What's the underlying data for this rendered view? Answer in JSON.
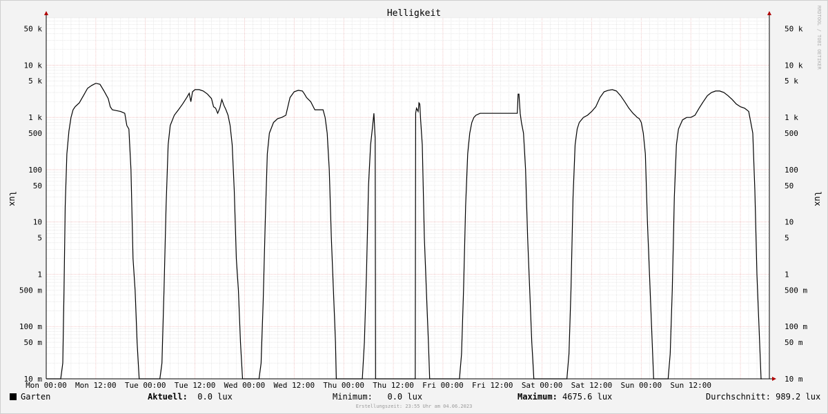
{
  "chart_data": {
    "type": "line",
    "title": "Helligkeit",
    "ylabel": "lux",
    "yscale": "log",
    "ylim": [
      0.01,
      80000
    ],
    "xlabel": "",
    "xlim_hours": [
      0,
      175
    ],
    "x_ticks": [
      "Mon 00:00",
      "Mon 12:00",
      "Tue 00:00",
      "Tue 12:00",
      "Wed 00:00",
      "Wed 12:00",
      "Thu 00:00",
      "Thu 12:00",
      "Fri 00:00",
      "Fri 12:00",
      "Sat 00:00",
      "Sat 12:00",
      "Sun 00:00",
      "Sun 12:00"
    ],
    "y_ticks": [
      {
        "v": 50000,
        "label": "50 k"
      },
      {
        "v": 10000,
        "label": "10 k"
      },
      {
        "v": 5000,
        "label": "5 k"
      },
      {
        "v": 1000,
        "label": "1 k"
      },
      {
        "v": 500,
        "label": "500"
      },
      {
        "v": 100,
        "label": "100"
      },
      {
        "v": 50,
        "label": "50"
      },
      {
        "v": 10,
        "label": "10"
      },
      {
        "v": 5,
        "label": "5"
      },
      {
        "v": 1,
        "label": "1"
      },
      {
        "v": 0.5,
        "label": "500 m"
      },
      {
        "v": 0.1,
        "label": "100 m"
      },
      {
        "v": 0.05,
        "label": "50 m"
      },
      {
        "v": 0.01,
        "label": "10 m"
      }
    ],
    "grid": true,
    "series": [
      {
        "name": "Garten",
        "color": "#000000",
        "x_hours": [
          0,
          3.5,
          4,
          4.3,
          4.6,
          5,
          5.5,
          6,
          6.5,
          7,
          8,
          9,
          10,
          11,
          12,
          13,
          14,
          15,
          15.5,
          16,
          17,
          18,
          19,
          19.5,
          20,
          20.5,
          21,
          21.5,
          22,
          22.5,
          22.7,
          27.5,
          28,
          28.5,
          29,
          29.5,
          30,
          31,
          32,
          33,
          34,
          34.6,
          35,
          35.4,
          36,
          37,
          38,
          39,
          40,
          40.5,
          41,
          41.5,
          42,
          42.5,
          43,
          43.5,
          44,
          44.5,
          45,
          45.5,
          46,
          46.5,
          47,
          47.5,
          47.9,
          51.5,
          52,
          52.5,
          53,
          53.5,
          54,
          55,
          56,
          57,
          58,
          59,
          60,
          61,
          62,
          62.5,
          63,
          64,
          65,
          66,
          67,
          67.5,
          68,
          68.5,
          69,
          69.5,
          70,
          70.2,
          76.5,
          77,
          77.5,
          78,
          78.5,
          79,
          79.3,
          79.6,
          79.7,
          89.3,
          89.4,
          89.6,
          90,
          90.2,
          90.4,
          90.6,
          91,
          91.5,
          92,
          92.5,
          92.8,
          100,
          100.5,
          101,
          101.5,
          102,
          102.5,
          103,
          103.5,
          104,
          105,
          106,
          107,
          108,
          110,
          112,
          113,
          114,
          114.2,
          114.4,
          114.7,
          115,
          115.5,
          116,
          116.5,
          117,
          117.5,
          118,
          118.2,
          126,
          126.5,
          127,
          127.5,
          128,
          128.5,
          129,
          130,
          131,
          132,
          133,
          134,
          135,
          136,
          137,
          138,
          139,
          140,
          141,
          142,
          142.5,
          143,
          143.5,
          144,
          144.5,
          145,
          145.5,
          146,
          146.5,
          147,
          147.3,
          150.5,
          151,
          151.5,
          152,
          152.5,
          153,
          154,
          155,
          156,
          157,
          158,
          159,
          160,
          161,
          162,
          163,
          164,
          165,
          166,
          167,
          168,
          169,
          169.5,
          170,
          170.5,
          171,
          171.5,
          172,
          172.5,
          173,
          173.2
        ],
        "y_lux": [
          0.01,
          0.01,
          0.02,
          0.5,
          20,
          200,
          550,
          1000,
          1400,
          1600,
          1900,
          2600,
          3600,
          4100,
          4500,
          4300,
          3200,
          2300,
          1600,
          1400,
          1350,
          1300,
          1200,
          700,
          600,
          100,
          2,
          0.5,
          0.05,
          0.01,
          0.01,
          0.01,
          0.02,
          0.5,
          20,
          300,
          700,
          1100,
          1400,
          1800,
          2400,
          2900,
          2000,
          3100,
          3400,
          3400,
          3200,
          2800,
          2300,
          1600,
          1500,
          1200,
          1500,
          2200,
          1700,
          1400,
          1100,
          700,
          300,
          40,
          2,
          0.5,
          0.05,
          0.01,
          0.01,
          0.01,
          0.02,
          0.3,
          10,
          200,
          500,
          800,
          950,
          1000,
          1100,
          2400,
          3100,
          3300,
          3200,
          2800,
          2400,
          2000,
          1400,
          1400,
          1400,
          1000,
          500,
          100,
          5,
          0.5,
          0.05,
          0.01,
          0.01,
          0.05,
          1,
          50,
          300,
          700,
          1200,
          400,
          0.01,
          0.01,
          1200,
          1500,
          1300,
          1900,
          1800,
          900,
          300,
          5,
          0.5,
          0.05,
          0.01,
          0.01,
          0.03,
          0.5,
          20,
          200,
          500,
          800,
          1000,
          1100,
          1200,
          1200,
          1200,
          1200,
          1200,
          1200,
          1200,
          1200,
          2800,
          2800,
          1200,
          800,
          500,
          100,
          5,
          0.5,
          0.05,
          0.01,
          0.01,
          0.01,
          0.03,
          0.5,
          30,
          300,
          600,
          800,
          1000,
          1100,
          1300,
          1600,
          2400,
          3100,
          3300,
          3400,
          3200,
          2600,
          2000,
          1500,
          1200,
          1100,
          1000,
          950,
          800,
          500,
          200,
          10,
          1,
          0.1,
          0.01,
          0.01,
          0.01,
          0.03,
          0.5,
          30,
          300,
          600,
          900,
          1000,
          1000,
          1100,
          1500,
          2000,
          2600,
          3000,
          3200,
          3200,
          3000,
          2600,
          2200,
          1800,
          1600,
          1500,
          1400,
          1300,
          800,
          500,
          40,
          1,
          0.1,
          0.01,
          0.01
        ]
      }
    ]
  },
  "legend": {
    "series_label": "Garten",
    "current_label": "Aktuell:",
    "current_value": "0.0 lux",
    "min_label": "Minimum:",
    "min_value": "0.0 lux",
    "max_label": "Maximum:",
    "max_value": "4675.6 lux",
    "avg_label": "Durchschnitt:",
    "avg_value": "989.2 lux"
  },
  "footer": "Erstellungszeit: 23:55 Uhr am 04.06.2023",
  "watermark": "RRDTOOL / TOBI OETIKER",
  "colors": {
    "line": "#000000",
    "grid_major": "#f0b8b8",
    "grid_minor": "#d9d9d9",
    "arrow": "#b00000"
  }
}
